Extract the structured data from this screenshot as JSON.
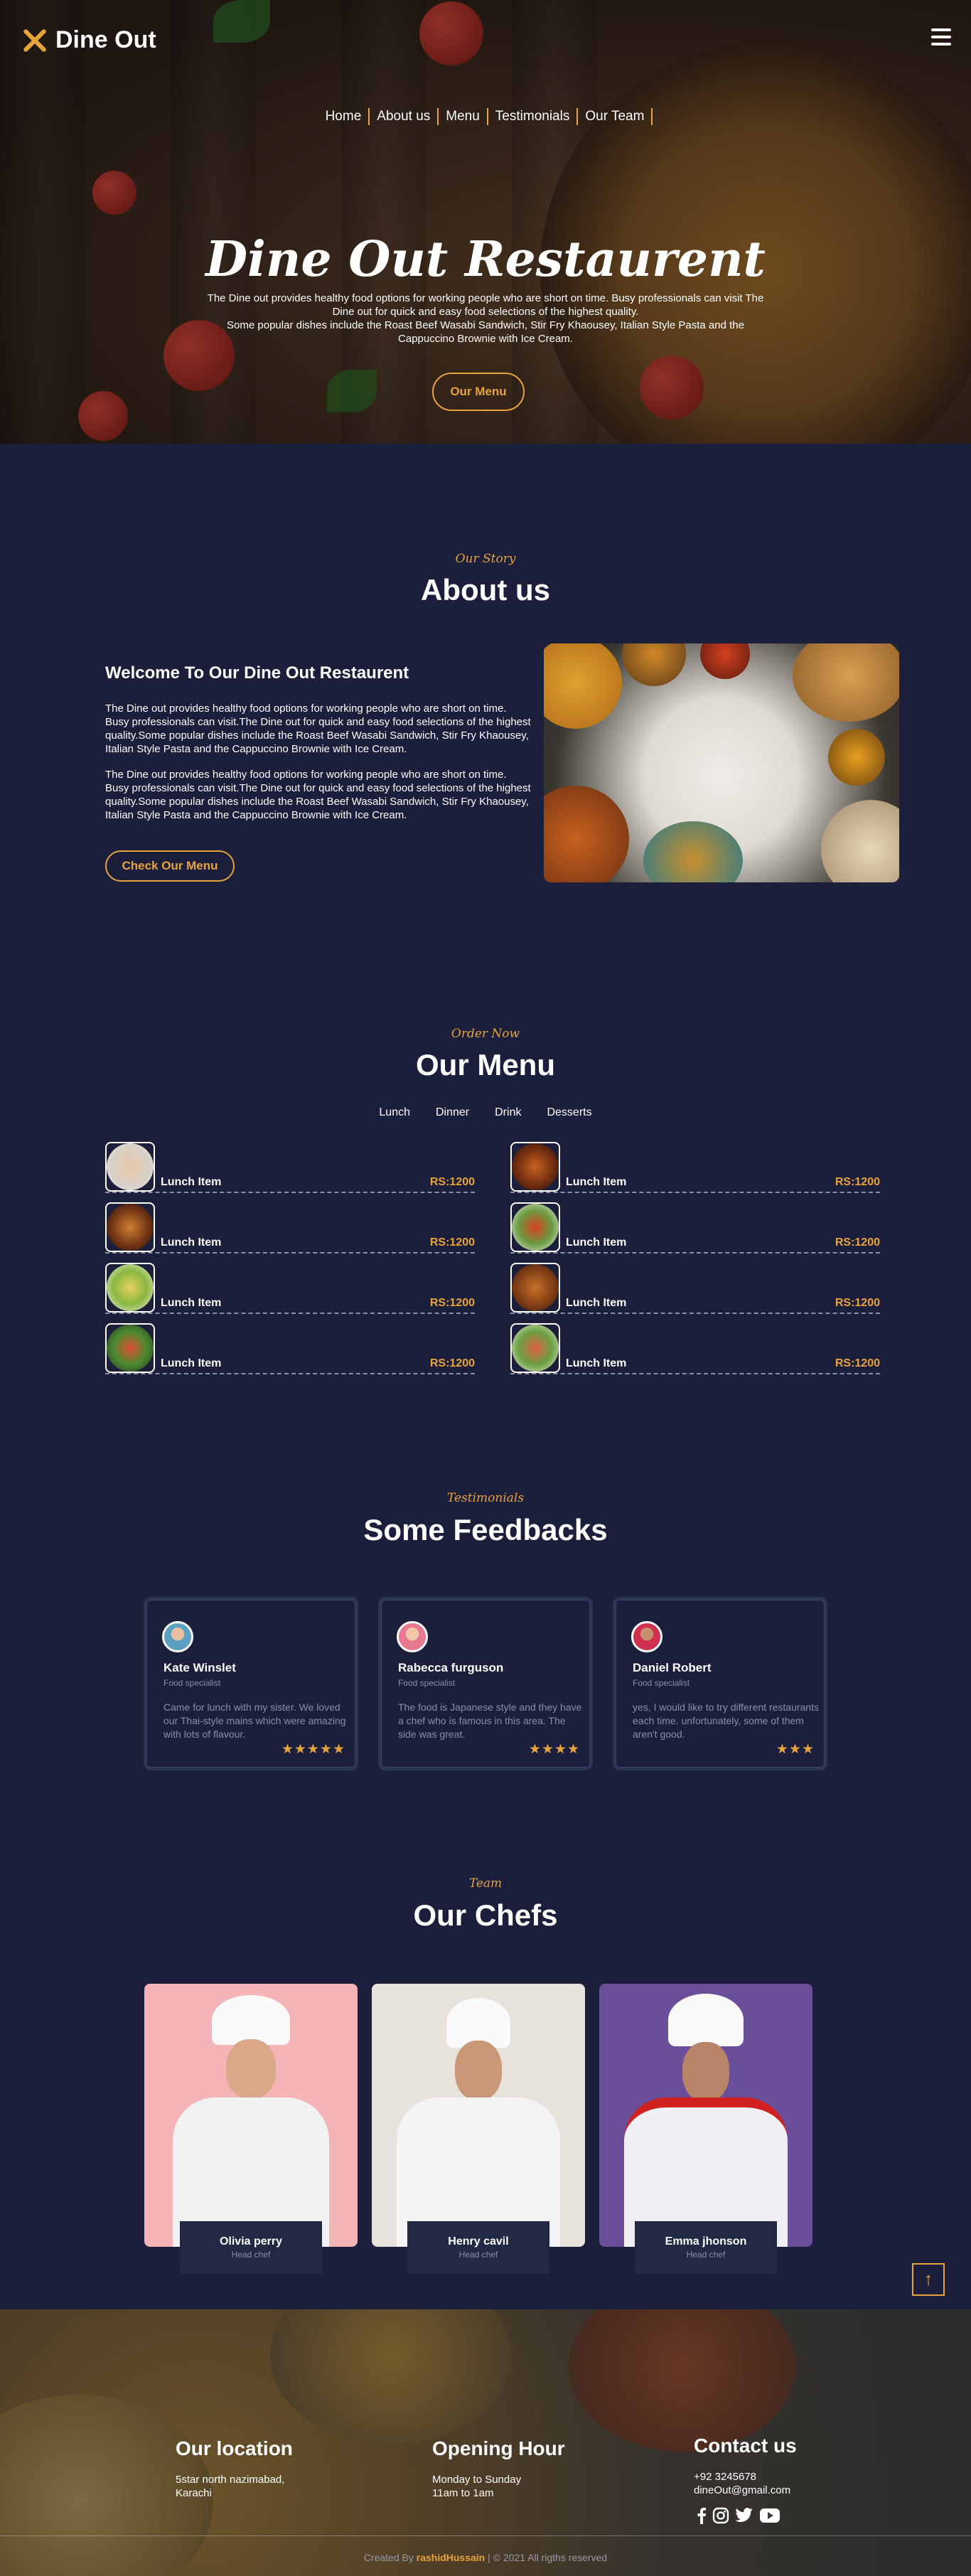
{
  "brand": {
    "name": "Dine Out"
  },
  "nav": {
    "items": [
      "Home",
      "About us",
      "Menu",
      "Testimonials",
      "Our Team"
    ]
  },
  "hero": {
    "title": "Dine Out Restaurent",
    "desc1": "The Dine out provides healthy food options for working people who are short on time. Busy professionals can visit The Dine out for quick and easy food selections of the highest quality.",
    "desc2": "Some popular dishes include the Roast Beef Wasabi Sandwich, Stir Fry Khaousey, Italian Style Pasta and the Cappuccino Brownie with Ice Cream.",
    "button": "Our Menu"
  },
  "about": {
    "subtitle": "Our Story",
    "title": "About us",
    "heading": "Welcome To Our Dine Out Restaurent",
    "p1": "The Dine out provides healthy food options for working people who are short on time. Busy professionals can visit.The Dine out for quick and easy food selections of the highest quality.Some popular dishes include the Roast Beef Wasabi Sandwich, Stir Fry Khaousey, Italian Style Pasta and the Cappuccino Brownie with Ice Cream.",
    "p2": "The Dine out provides healthy food options for working people who are short on time. Busy professionals can visit.The Dine out for quick and easy food selections of the highest quality.Some popular dishes include the Roast Beef Wasabi Sandwich, Stir Fry Khaousey, Italian Style Pasta and the Cappuccino Brownie with Ice Cream.",
    "button": "Check Our Menu"
  },
  "menu": {
    "subtitle": "Order Now",
    "title": "Our Menu",
    "tabs": [
      "Lunch",
      "Dinner",
      "Drink",
      "Desserts"
    ],
    "items": [
      {
        "name": "Lunch Item",
        "price": "RS:1200"
      },
      {
        "name": "Lunch Item",
        "price": "RS:1200"
      },
      {
        "name": "Lunch Item",
        "price": "RS:1200"
      },
      {
        "name": "Lunch Item",
        "price": "RS:1200"
      },
      {
        "name": "Lunch Item",
        "price": "RS:1200"
      },
      {
        "name": "Lunch Item",
        "price": "RS:1200"
      },
      {
        "name": "Lunch Item",
        "price": "RS:1200"
      },
      {
        "name": "Lunch Item",
        "price": "RS:1200"
      }
    ]
  },
  "testimonials": {
    "subtitle": "Testimonials",
    "title": "Some Feedbacks",
    "items": [
      {
        "name": "Kate Winslet",
        "role": "Food specialist",
        "text": "Came for lunch with my sister. We loved our Thai-style mains which were amazing with lots of flavour.",
        "rating": 5,
        "stars": "★★★★★"
      },
      {
        "name": "Rabecca furguson",
        "role": "Food specialist",
        "text": "The food is Japanese style and they have a chef who is famous in this area. The side was great.",
        "rating": 4,
        "stars": "★★★★"
      },
      {
        "name": "Daniel Robert",
        "role": "Food specialist",
        "text": "yes, I would like to try different restaurants each time. unfortunately, some of them aren't good.",
        "rating": 3,
        "stars": "★★★"
      }
    ]
  },
  "team": {
    "subtitle": "Team",
    "title": "Our Chefs",
    "chefs": [
      {
        "name": "Olivia perry",
        "role": "Head chef"
      },
      {
        "name": "Henry cavil",
        "role": "Head chef"
      },
      {
        "name": "Emma jhonson",
        "role": "Head chef"
      }
    ]
  },
  "footer": {
    "location": {
      "title": "Our location",
      "line1": "5star north nazimabad,",
      "line2": "Karachi"
    },
    "hours": {
      "title": "Opening Hour",
      "line1": "Monday to Sunday",
      "line2": "11am to 1am"
    },
    "contact": {
      "title": "Contact us",
      "phone": "+92 3245678",
      "email": "dineOut@gmail.com"
    },
    "copy_prefix": "Created By ",
    "copy_author": "rashidHussain",
    "copy_suffix": " | © 2021 All rigths reserved"
  },
  "colors": {
    "accent": "#e8a33a",
    "background": "#1b1f3b",
    "card_border": "#2c3554"
  }
}
